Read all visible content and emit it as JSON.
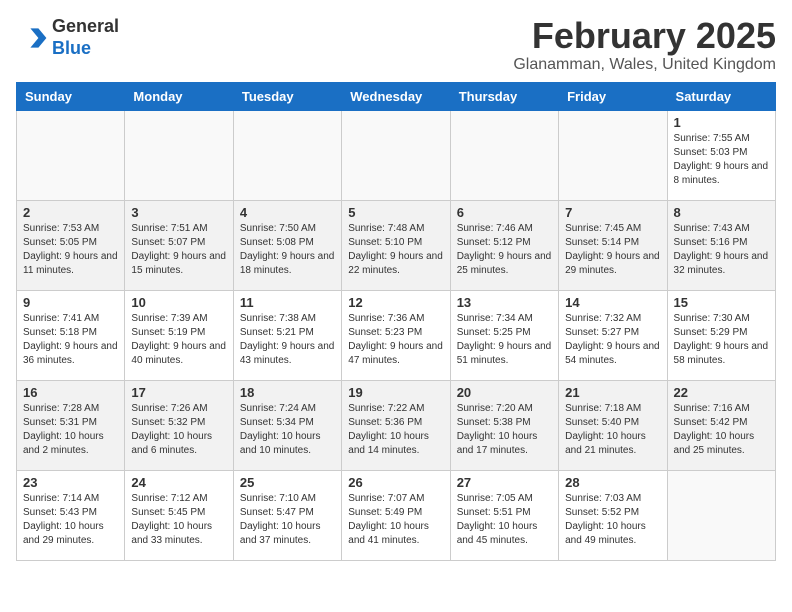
{
  "header": {
    "logo_line1": "General",
    "logo_line2": "Blue",
    "title": "February 2025",
    "subtitle": "Glanamman, Wales, United Kingdom"
  },
  "weekdays": [
    "Sunday",
    "Monday",
    "Tuesday",
    "Wednesday",
    "Thursday",
    "Friday",
    "Saturday"
  ],
  "weeks": [
    [
      {
        "day": "",
        "info": ""
      },
      {
        "day": "",
        "info": ""
      },
      {
        "day": "",
        "info": ""
      },
      {
        "day": "",
        "info": ""
      },
      {
        "day": "",
        "info": ""
      },
      {
        "day": "",
        "info": ""
      },
      {
        "day": "1",
        "info": "Sunrise: 7:55 AM\nSunset: 5:03 PM\nDaylight: 9 hours and 8 minutes."
      }
    ],
    [
      {
        "day": "2",
        "info": "Sunrise: 7:53 AM\nSunset: 5:05 PM\nDaylight: 9 hours and 11 minutes."
      },
      {
        "day": "3",
        "info": "Sunrise: 7:51 AM\nSunset: 5:07 PM\nDaylight: 9 hours and 15 minutes."
      },
      {
        "day": "4",
        "info": "Sunrise: 7:50 AM\nSunset: 5:08 PM\nDaylight: 9 hours and 18 minutes."
      },
      {
        "day": "5",
        "info": "Sunrise: 7:48 AM\nSunset: 5:10 PM\nDaylight: 9 hours and 22 minutes."
      },
      {
        "day": "6",
        "info": "Sunrise: 7:46 AM\nSunset: 5:12 PM\nDaylight: 9 hours and 25 minutes."
      },
      {
        "day": "7",
        "info": "Sunrise: 7:45 AM\nSunset: 5:14 PM\nDaylight: 9 hours and 29 minutes."
      },
      {
        "day": "8",
        "info": "Sunrise: 7:43 AM\nSunset: 5:16 PM\nDaylight: 9 hours and 32 minutes."
      }
    ],
    [
      {
        "day": "9",
        "info": "Sunrise: 7:41 AM\nSunset: 5:18 PM\nDaylight: 9 hours and 36 minutes."
      },
      {
        "day": "10",
        "info": "Sunrise: 7:39 AM\nSunset: 5:19 PM\nDaylight: 9 hours and 40 minutes."
      },
      {
        "day": "11",
        "info": "Sunrise: 7:38 AM\nSunset: 5:21 PM\nDaylight: 9 hours and 43 minutes."
      },
      {
        "day": "12",
        "info": "Sunrise: 7:36 AM\nSunset: 5:23 PM\nDaylight: 9 hours and 47 minutes."
      },
      {
        "day": "13",
        "info": "Sunrise: 7:34 AM\nSunset: 5:25 PM\nDaylight: 9 hours and 51 minutes."
      },
      {
        "day": "14",
        "info": "Sunrise: 7:32 AM\nSunset: 5:27 PM\nDaylight: 9 hours and 54 minutes."
      },
      {
        "day": "15",
        "info": "Sunrise: 7:30 AM\nSunset: 5:29 PM\nDaylight: 9 hours and 58 minutes."
      }
    ],
    [
      {
        "day": "16",
        "info": "Sunrise: 7:28 AM\nSunset: 5:31 PM\nDaylight: 10 hours and 2 minutes."
      },
      {
        "day": "17",
        "info": "Sunrise: 7:26 AM\nSunset: 5:32 PM\nDaylight: 10 hours and 6 minutes."
      },
      {
        "day": "18",
        "info": "Sunrise: 7:24 AM\nSunset: 5:34 PM\nDaylight: 10 hours and 10 minutes."
      },
      {
        "day": "19",
        "info": "Sunrise: 7:22 AM\nSunset: 5:36 PM\nDaylight: 10 hours and 14 minutes."
      },
      {
        "day": "20",
        "info": "Sunrise: 7:20 AM\nSunset: 5:38 PM\nDaylight: 10 hours and 17 minutes."
      },
      {
        "day": "21",
        "info": "Sunrise: 7:18 AM\nSunset: 5:40 PM\nDaylight: 10 hours and 21 minutes."
      },
      {
        "day": "22",
        "info": "Sunrise: 7:16 AM\nSunset: 5:42 PM\nDaylight: 10 hours and 25 minutes."
      }
    ],
    [
      {
        "day": "23",
        "info": "Sunrise: 7:14 AM\nSunset: 5:43 PM\nDaylight: 10 hours and 29 minutes."
      },
      {
        "day": "24",
        "info": "Sunrise: 7:12 AM\nSunset: 5:45 PM\nDaylight: 10 hours and 33 minutes."
      },
      {
        "day": "25",
        "info": "Sunrise: 7:10 AM\nSunset: 5:47 PM\nDaylight: 10 hours and 37 minutes."
      },
      {
        "day": "26",
        "info": "Sunrise: 7:07 AM\nSunset: 5:49 PM\nDaylight: 10 hours and 41 minutes."
      },
      {
        "day": "27",
        "info": "Sunrise: 7:05 AM\nSunset: 5:51 PM\nDaylight: 10 hours and 45 minutes."
      },
      {
        "day": "28",
        "info": "Sunrise: 7:03 AM\nSunset: 5:52 PM\nDaylight: 10 hours and 49 minutes."
      },
      {
        "day": "",
        "info": ""
      }
    ]
  ]
}
